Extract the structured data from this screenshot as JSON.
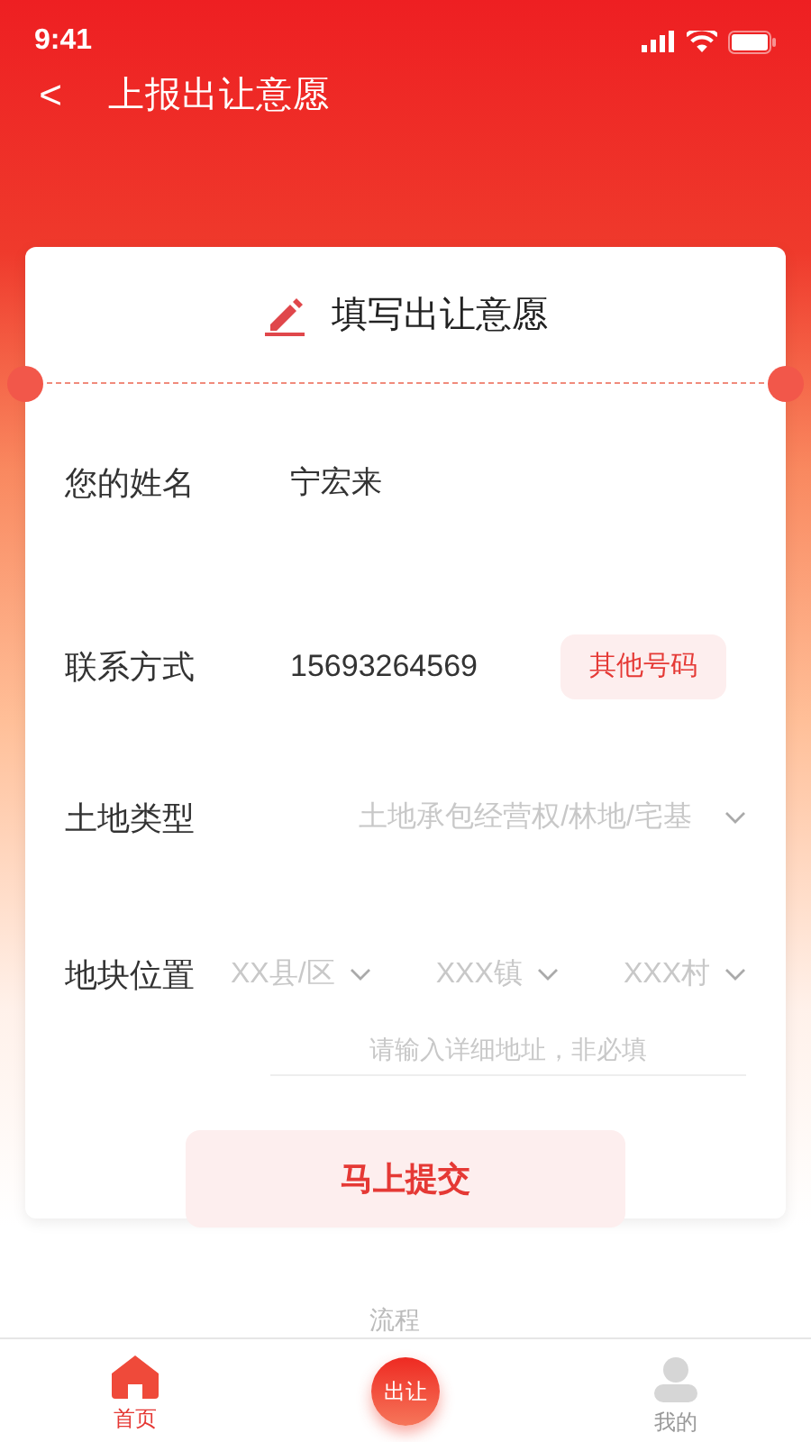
{
  "status_bar": {
    "time": "9:41"
  },
  "nav": {
    "back": "<",
    "title": "上报出让意愿"
  },
  "card": {
    "title": "填写出让意愿",
    "fields": [
      {
        "kind": "text",
        "label": "您的姓名",
        "value": "宁宏来"
      },
      {
        "kind": "phone",
        "label": "联系方式",
        "value": "15693264569",
        "action": "其他号码"
      },
      {
        "kind": "select",
        "label": "土地类型",
        "placeholder": "土地承包经营权/林地/宅基"
      },
      {
        "kind": "location",
        "label": "地块位置",
        "selects": [
          "XX县/区",
          "XXX镇",
          "XXX村"
        ],
        "placeholder": "请输入详细地址，非必填"
      }
    ],
    "submit": "马上提交"
  },
  "section_label": "流程",
  "tab_bar": [
    {
      "kind": "home",
      "label": "首页",
      "selected": true
    },
    {
      "kind": "center",
      "label": "出让",
      "selected": false
    },
    {
      "kind": "profile",
      "label": "我的",
      "selected": false
    }
  ]
}
